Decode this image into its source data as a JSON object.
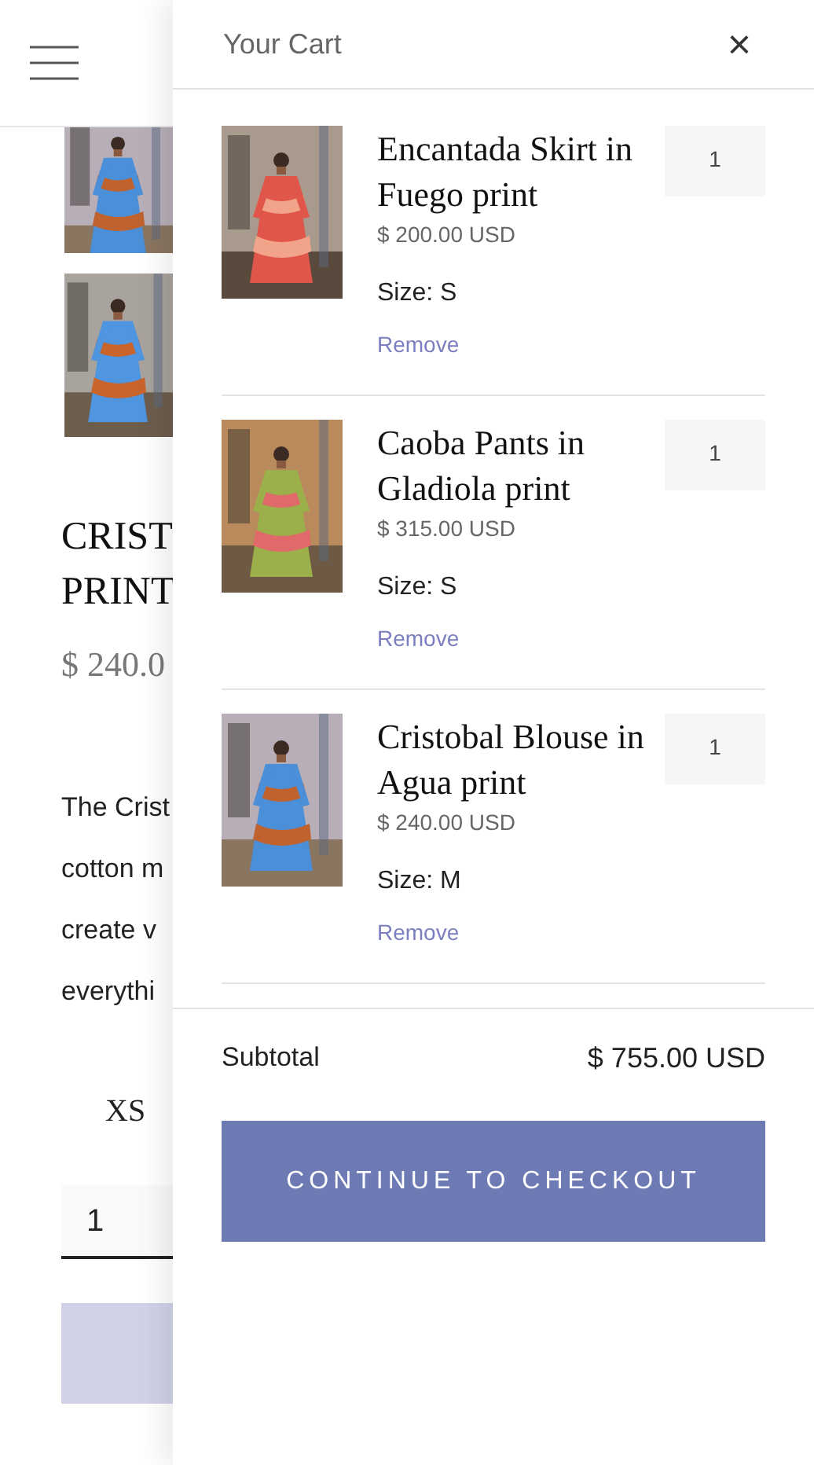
{
  "product_page": {
    "heading_lines": [
      "CRIST",
      "PRINT"
    ],
    "price": "$ 240.0",
    "description_lines": [
      "The Crist",
      "cotton m",
      "create v",
      "everythi"
    ],
    "size_option": "XS",
    "quantity": "1",
    "thumbnails": [
      {
        "kind": "picture"
      },
      {
        "kind": "picture"
      }
    ]
  },
  "cart": {
    "title": "Your Cart",
    "close": "×",
    "items": [
      {
        "name": "Encantada Skirt in Fuego print",
        "price": "$ 200.00 USD",
        "size": "Size: S",
        "remove": "Remove",
        "quantity": "1",
        "image": {
          "kind": "picture"
        }
      },
      {
        "name": "Caoba Pants in Gladiola print",
        "price": "$ 315.00 USD",
        "size": "Size: S",
        "remove": "Remove",
        "quantity": "1",
        "image": {
          "kind": "picture"
        }
      },
      {
        "name": "Cristobal Blouse in Agua print",
        "price": "$ 240.00 USD",
        "size": "Size: M",
        "remove": "Remove",
        "quantity": "1",
        "image": {
          "kind": "picture"
        }
      }
    ],
    "subtotal_label": "Subtotal",
    "subtotal": "$ 755.00 USD",
    "checkout": "CONTINUE TO CHECKOUT"
  }
}
